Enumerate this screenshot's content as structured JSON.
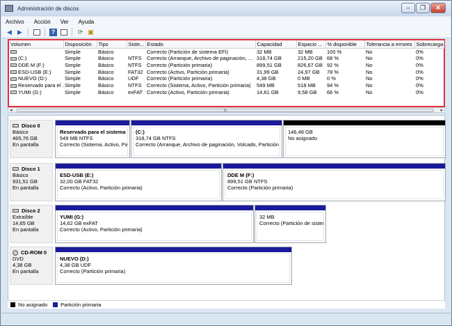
{
  "window": {
    "title": "Administración de discos"
  },
  "menu": [
    "Archivo",
    "Acción",
    "Ver",
    "Ayuda"
  ],
  "columns": [
    "Volumen",
    "Disposición",
    "Tipo",
    "Siste...",
    "Estado",
    "Capacidad",
    "Espacio ...",
    "% disponible",
    "Tolerancia a errores",
    "Sobrecarga"
  ],
  "volumes": [
    [
      "",
      "Simple",
      "Básico",
      "",
      "Correcto (Partición de sistema EFI)",
      "32 MB",
      "32 MB",
      "100 %",
      "No",
      "0%"
    ],
    [
      "(C:)",
      "Simple",
      "Básico",
      "NTFS",
      "Correcto (Arranque, Archivo de paginación, ...",
      "318,74 GB",
      "215,20 GB",
      "68 %",
      "No",
      "0%"
    ],
    [
      "DDE M (F:)",
      "Simple",
      "Básico",
      "NTFS",
      "Correcto (Partición primaria)",
      "899,51 GB",
      "826,67 GB",
      "92 %",
      "No",
      "0%"
    ],
    [
      "ESD-USB (E:)",
      "Simple",
      "Básico",
      "FAT32",
      "Correcto (Activo, Partición primaria)",
      "31,99 GB",
      "24,97 GB",
      "78 %",
      "No",
      "0%"
    ],
    [
      "NUEVO (D:)",
      "Simple",
      "Básico",
      "UDF",
      "Correcto (Partición primaria)",
      "4,38 GB",
      "0 MB",
      "0 %",
      "No",
      "0%"
    ],
    [
      "Reservado para el ...",
      "Simple",
      "Básico",
      "NTFS",
      "Correcto (Sistema, Activo, Partición primaria)",
      "549 MB",
      "518 MB",
      "94 %",
      "No",
      "0%"
    ],
    [
      "YUMI (G:)",
      "Simple",
      "Básico",
      "exFAT",
      "Correcto (Activo, Partición primaria)",
      "14,61 GB",
      "9,58 GB",
      "66 %",
      "No",
      "0%"
    ]
  ],
  "scroll_label": "III",
  "disks": [
    {
      "name": "Disco 0",
      "type": "Básico",
      "size": "465,76 GB",
      "state": "En pantalla",
      "parts": [
        {
          "name": "Reservado para el sistema",
          "size": "549 MB NTFS",
          "status": "Correcto (Sistema, Activo, Part"
        },
        {
          "name": "(C:)",
          "size": "318,74 GB NTFS",
          "status": "Correcto (Arranque, Archivo de paginación, Volcado, Partición p"
        },
        {
          "name": "",
          "size": "146,48 GB",
          "status": "No asignado"
        }
      ]
    },
    {
      "name": "Disco 1",
      "type": "Básico",
      "size": "931,51 GB",
      "state": "En pantalla",
      "parts": [
        {
          "name": "ESD-USB  (E:)",
          "size": "32,00 GB FAT32",
          "status": "Correcto (Activo, Partición primaria)"
        },
        {
          "name": "DDE M  (F:)",
          "size": "899,51 GB NTFS",
          "status": "Correcto (Partición primaria)"
        }
      ]
    },
    {
      "name": "Disco 2",
      "type": "Extraíble",
      "size": "14,65 GB",
      "state": "En pantalla",
      "parts": [
        {
          "name": "YUMI  (G:)",
          "size": "14,62 GB exFAT",
          "status": "Correcto (Activo, Partición primaria)"
        },
        {
          "name": "",
          "size": "32 MB",
          "status": "Correcto (Partición de sistem"
        }
      ]
    },
    {
      "name": "CD-ROM 0",
      "type": "DVD",
      "size": "4,38 GB",
      "state": "En pantalla",
      "parts": [
        {
          "name": "NUEVO  (D:)",
          "size": "4,38 GB UDF",
          "status": "Correcto (Partición primaria)"
        }
      ]
    }
  ],
  "legend": [
    {
      "label": "No asignado",
      "color": "#000000"
    },
    {
      "label": "Partición primaria",
      "color": "#1a1a9a"
    }
  ]
}
